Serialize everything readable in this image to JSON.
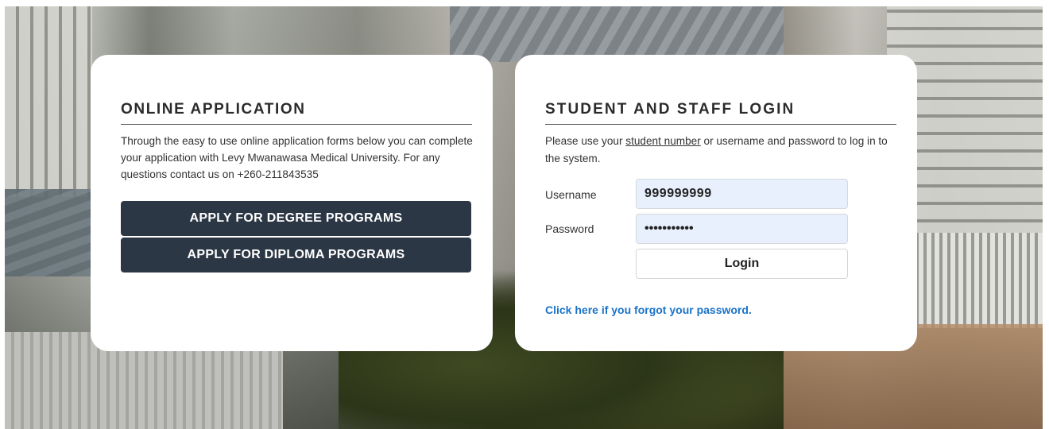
{
  "colors": {
    "button_dark": "#2c3745",
    "link_blue": "#1a73c9",
    "autofill_bg": "#e8f0fe"
  },
  "application": {
    "title": "ONLINE APPLICATION",
    "intro": "Through the easy to use online application forms below you can complete your application with Levy Mwanawasa Medical University. For any questions contact us on +260-211843535",
    "degree_button": "APPLY FOR DEGREE PROGRAMS",
    "diploma_button": "APPLY FOR DIPLOMA PROGRAMS"
  },
  "login": {
    "title": "STUDENT AND STAFF LOGIN",
    "intro_before": "Please use your ",
    "intro_link": "student number",
    "intro_after": " or username and password to log in to the system.",
    "username_label": "Username",
    "username_value": "999999999",
    "password_label": "Password",
    "password_value": "•••••••••••",
    "login_button": "Login",
    "forgot_link": "Click here if you forgot your password."
  }
}
